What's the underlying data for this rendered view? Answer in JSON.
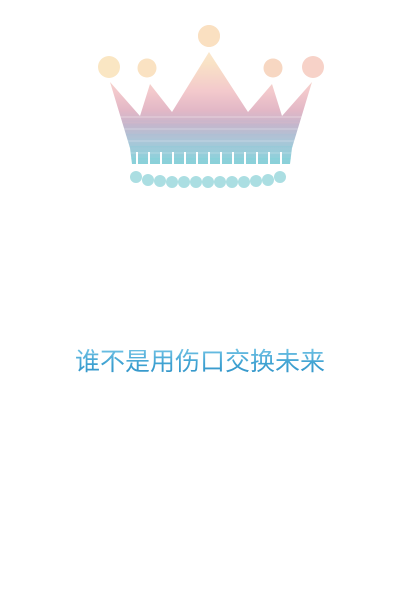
{
  "quote": {
    "text": "谁不是用伤口交换未来"
  },
  "crown": {
    "icon": "crown-icon",
    "colors": {
      "sky_top": "#f9e3c4",
      "sky_mid": "#f3c8cc",
      "sea_top": "#c9b3c8",
      "sea_mid": "#a9c8d8",
      "sea_bottom": "#7fd2d8",
      "beads": "#a8dde2"
    }
  },
  "colors": {
    "text_top": "#7ecbea",
    "text_bottom": "#2f8fc4",
    "background": "#ffffff"
  }
}
